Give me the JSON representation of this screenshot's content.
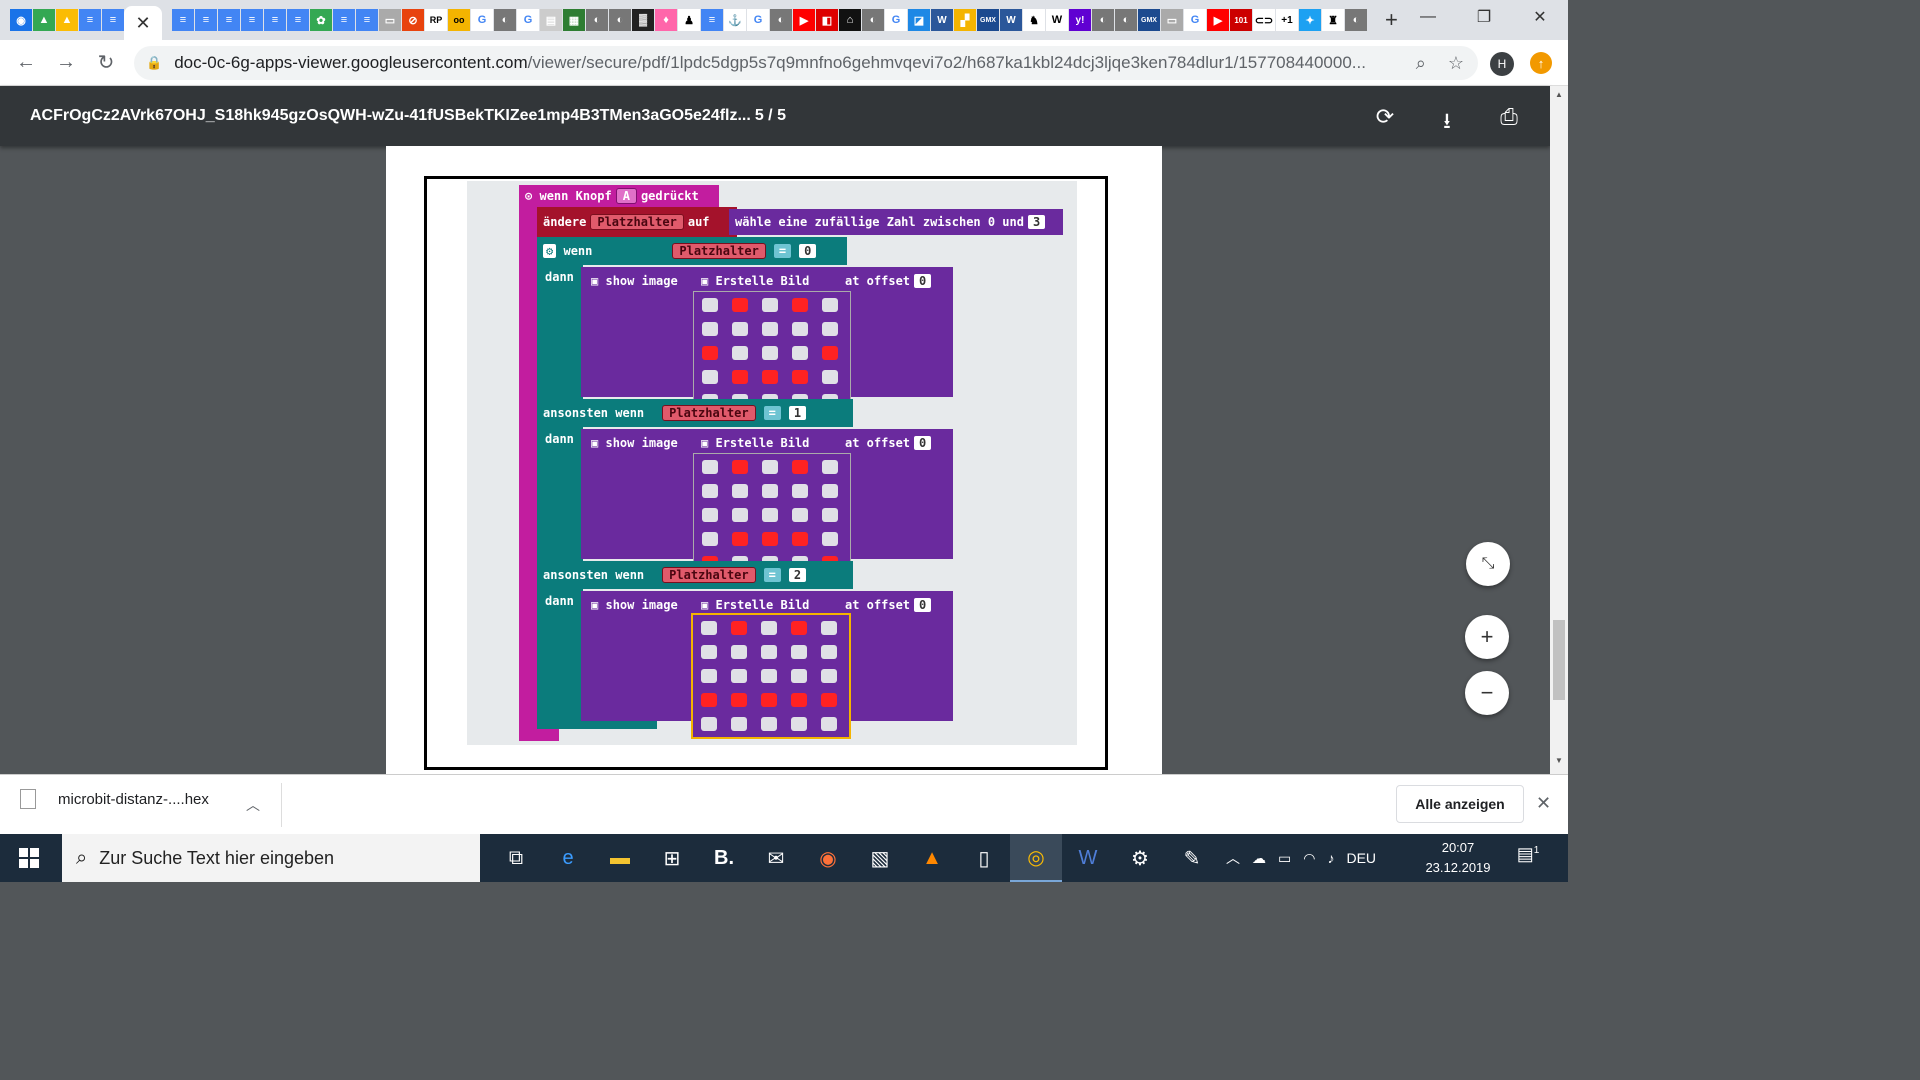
{
  "browser": {
    "active_tab_close": "✕",
    "new_tab": "+",
    "window": {
      "minimize": "—",
      "restore": "❐",
      "close": "✕"
    },
    "url_host": "doc-0c-6g-apps-viewer.googleusercontent.com",
    "url_path": "/viewer/secure/pdf/1lpdc5dgp5s7q9mnfno6gehmvqevi7o2/h687ka1kbl24dcj3ljqe3ken784dlur1/157708440000...",
    "profile_initial": "H"
  },
  "pdf": {
    "title": "ACFrOgCz2AVrk67OHJ_S18hk945gzOsQWH-wZu-41fUSBekTKIZee1mp4B3TMen3aGO5e24flz...",
    "pages": "5 / 5"
  },
  "blocks": {
    "hat_label": "wenn Knopf",
    "hat_button": "A",
    "hat_suffix": "gedrückt",
    "set_label": "ändere",
    "var_name": "Platzhalter",
    "set_to": "auf",
    "random_label": "wähle eine zufällige Zahl zwischen 0 und",
    "random_max": "3",
    "if_label": "wenn",
    "then_label": "dann",
    "elseif_label": "ansonsten wenn",
    "eq": "=",
    "show_image": "show image",
    "create_image": "Erstelle Bild",
    "at_offset": "at offset",
    "offset_value": "0",
    "cond_values": [
      "0",
      "1",
      "2"
    ]
  },
  "led_grids": [
    [
      0,
      1,
      0,
      1,
      0,
      0,
      0,
      0,
      0,
      0,
      1,
      0,
      0,
      0,
      1,
      0,
      1,
      1,
      1,
      0,
      0,
      0,
      0,
      0,
      0
    ],
    [
      0,
      1,
      0,
      1,
      0,
      0,
      0,
      0,
      0,
      0,
      0,
      0,
      0,
      0,
      0,
      0,
      1,
      1,
      1,
      0,
      1,
      0,
      0,
      0,
      1
    ],
    [
      0,
      1,
      0,
      1,
      0,
      0,
      0,
      0,
      0,
      0,
      0,
      0,
      0,
      0,
      0,
      1,
      1,
      1,
      1,
      1,
      0,
      0,
      0,
      0,
      0
    ]
  ],
  "downloads": {
    "file_name": "microbit-distanz-....hex",
    "show_all": "Alle anzeigen"
  },
  "taskbar": {
    "search_placeholder": "Zur Suche Text hier eingeben",
    "language": "DEU",
    "time": "20:07",
    "date": "23.12.2019",
    "notifications": "1"
  }
}
